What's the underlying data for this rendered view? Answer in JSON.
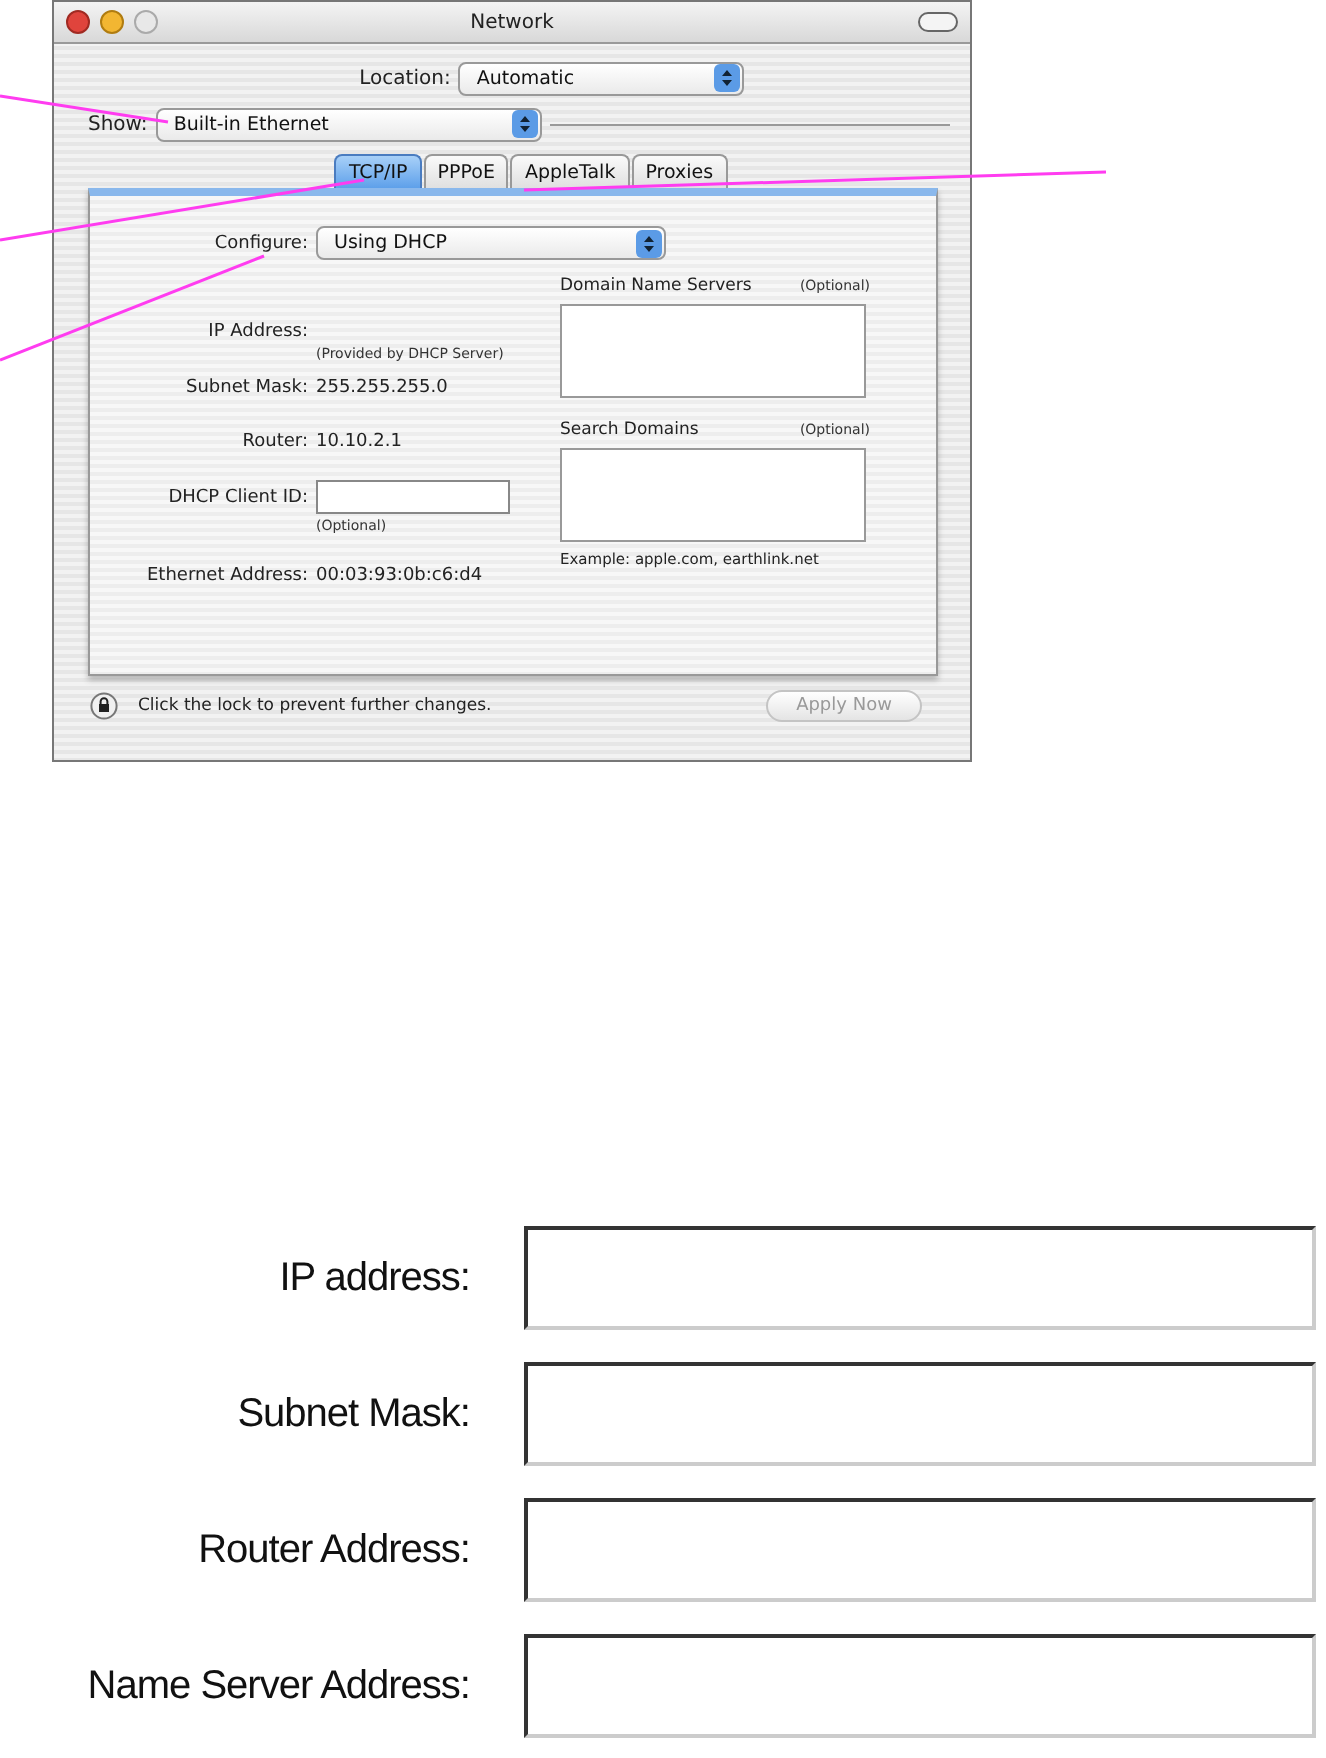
{
  "window": {
    "title": "Network"
  },
  "location": {
    "label": "Location:",
    "value": "Automatic"
  },
  "show": {
    "label": "Show:",
    "value": "Built-in Ethernet"
  },
  "tabs": [
    {
      "label": "TCP/IP",
      "selected": true
    },
    {
      "label": "PPPoE",
      "selected": false
    },
    {
      "label": "AppleTalk",
      "selected": false
    },
    {
      "label": "Proxies",
      "selected": false
    }
  ],
  "configure": {
    "label": "Configure:",
    "value": "Using DHCP"
  },
  "ip_address": {
    "label": "IP Address:",
    "note": "(Provided by DHCP Server)"
  },
  "subnet_mask": {
    "label": "Subnet Mask:",
    "value": "255.255.255.0"
  },
  "router": {
    "label": "Router:",
    "value": "10.10.2.1"
  },
  "dhcp_client_id": {
    "label": "DHCP Client ID:",
    "note": "(Optional)"
  },
  "ethernet_address": {
    "label": "Ethernet Address:",
    "value": "00:03:93:0b:c6:d4"
  },
  "domain_name_servers": {
    "label": "Domain Name Servers",
    "note": "(Optional)"
  },
  "search_domains": {
    "label": "Search Domains",
    "note": "(Optional)",
    "example": "Example: apple.com, earthlink.net"
  },
  "lock_message": "Click the lock to prevent further changes.",
  "apply_button": {
    "label": "Apply Now",
    "disabled": true
  },
  "form_fields": [
    {
      "label": "IP address:"
    },
    {
      "label": "Subnet Mask:"
    },
    {
      "label": "Router Address:"
    },
    {
      "label": "Name Server Address:"
    }
  ]
}
